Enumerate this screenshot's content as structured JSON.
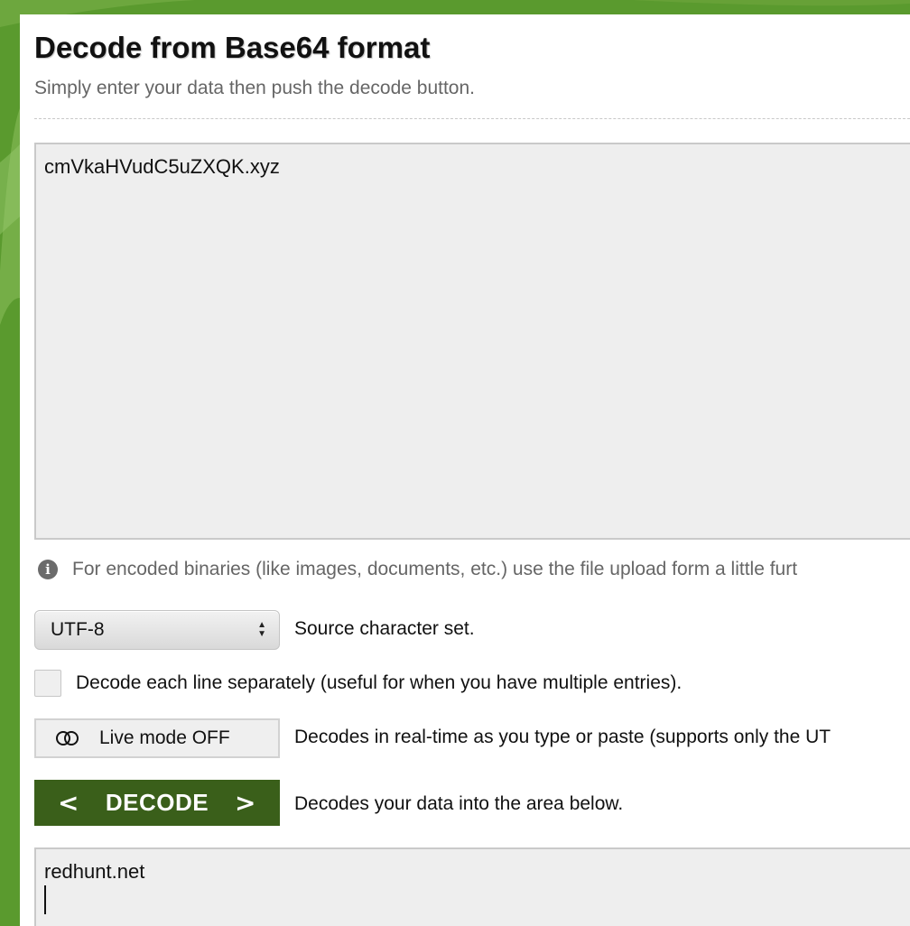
{
  "page": {
    "title": "Decode from Base64 format",
    "subtitle": "Simply enter your data then push the decode button."
  },
  "input": {
    "value": "cmVkaHVudC5uZXQK.xyz"
  },
  "info": {
    "icon": "info-icon",
    "text": "For encoded binaries (like images, documents, etc.) use the file upload form a little furt"
  },
  "charset": {
    "selected": "UTF-8",
    "label": "Source character set."
  },
  "line_option": {
    "checked": false,
    "label": "Decode each line separately (useful for when you have multiple entries)."
  },
  "live_mode": {
    "button_label": "Live mode OFF",
    "description": "Decodes in real-time as you type or paste (supports only the UT"
  },
  "decode": {
    "button_label": "DECODE",
    "description": "Decodes your data into the area below."
  },
  "output": {
    "value": "redhunt.net"
  },
  "colors": {
    "page_background": "#5a9a2e",
    "decode_button": "#3a5f1a"
  }
}
